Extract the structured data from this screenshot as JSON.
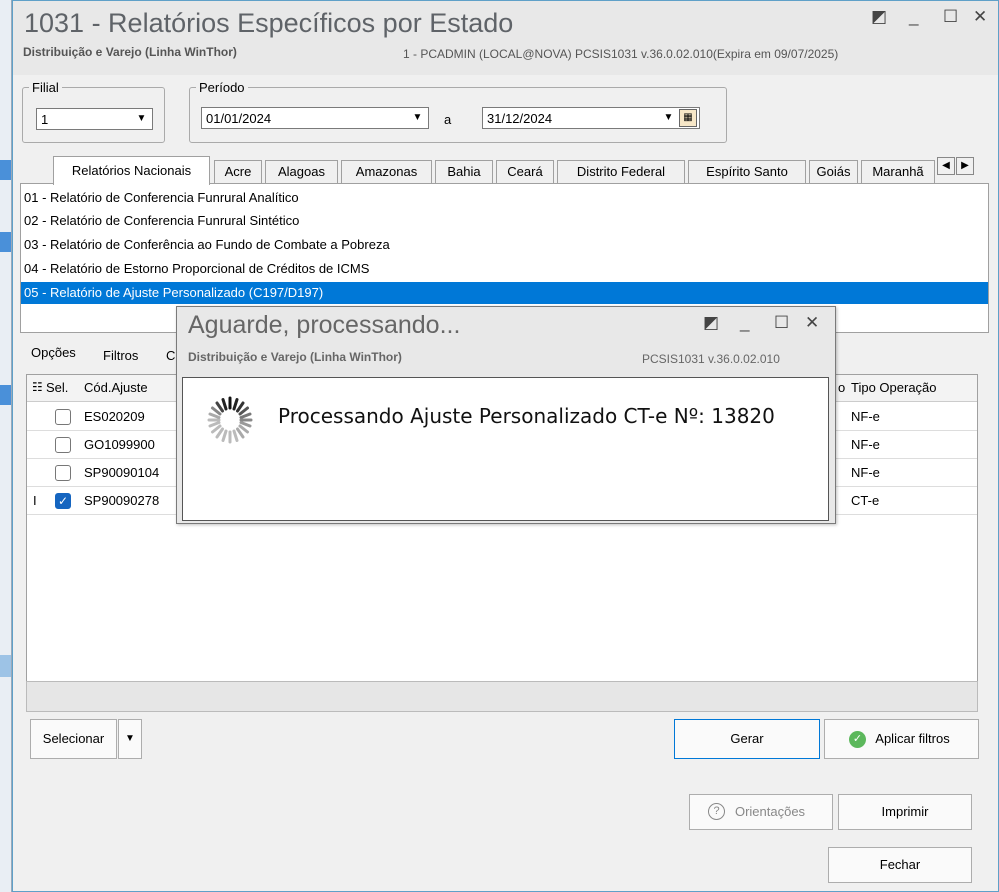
{
  "window": {
    "title": "1031 - Relatórios Específicos por Estado",
    "subtitle": "Distribuição e Varejo (Linha WinThor)",
    "info": "1 - PCADMIN (LOCAL@NOVA)   PCSIS1031  v.36.0.02.010(Expira em 09/07/2025)"
  },
  "filial": {
    "label": "Filial",
    "value": "1"
  },
  "periodo": {
    "label": "Período",
    "start": "01/01/2024",
    "separator": "a",
    "end": "31/12/2024"
  },
  "tabs": [
    {
      "label": "Relatórios Nacionais"
    },
    {
      "label": "Acre"
    },
    {
      "label": "Alagoas"
    },
    {
      "label": "Amazonas"
    },
    {
      "label": "Bahia"
    },
    {
      "label": "Ceará"
    },
    {
      "label": "Distrito Federal"
    },
    {
      "label": "Espírito Santo"
    },
    {
      "label": "Goiás"
    },
    {
      "label": "Maranhã"
    }
  ],
  "reports": [
    {
      "label": "01 - Relatório de Conferencia Funrural Analítico"
    },
    {
      "label": "02 - Relatório de Conferencia Funrural Sintético"
    },
    {
      "label": "03 - Relatório de Conferência ao Fundo de Combate a Pobreza"
    },
    {
      "label": "04 - Relatório de Estorno Proporcional de Créditos de ICMS"
    },
    {
      "label": "05 - Relatório de Ajuste Personalizado (C197/D197)"
    }
  ],
  "lower_tabs": {
    "opcoes": "Opções",
    "filtros": "Filtros",
    "third": "C"
  },
  "grid": {
    "headers": {
      "sel": "Sel.",
      "cod": "Cód.Ajuste",
      "partial": "o",
      "tipo": "Tipo Operação"
    },
    "rows": [
      {
        "cod": "ES020209",
        "tipo": "NF-e",
        "checked": false
      },
      {
        "cod": "GO1099900",
        "tipo": "NF-e",
        "checked": false
      },
      {
        "cod": "SP90090104",
        "tipo": "NF-e",
        "checked": false
      },
      {
        "cod": "SP90090278",
        "tipo": "CT-e",
        "checked": true
      }
    ]
  },
  "buttons": {
    "selecionar": "Selecionar",
    "gerar": "Gerar",
    "aplicar": "Aplicar filtros",
    "orientacoes": "Orientações",
    "imprimir": "Imprimir",
    "fechar": "Fechar"
  },
  "modal": {
    "title": "Aguarde, processando...",
    "subtitle": "Distribuição e Varejo (Linha WinThor)",
    "version": "PCSIS1031  v.36.0.02.010",
    "message": "Processando Ajuste Personalizado CT-e Nº: 13820"
  },
  "colors": {
    "accent": "#0078d7",
    "window_border": "#5fa0c8"
  }
}
